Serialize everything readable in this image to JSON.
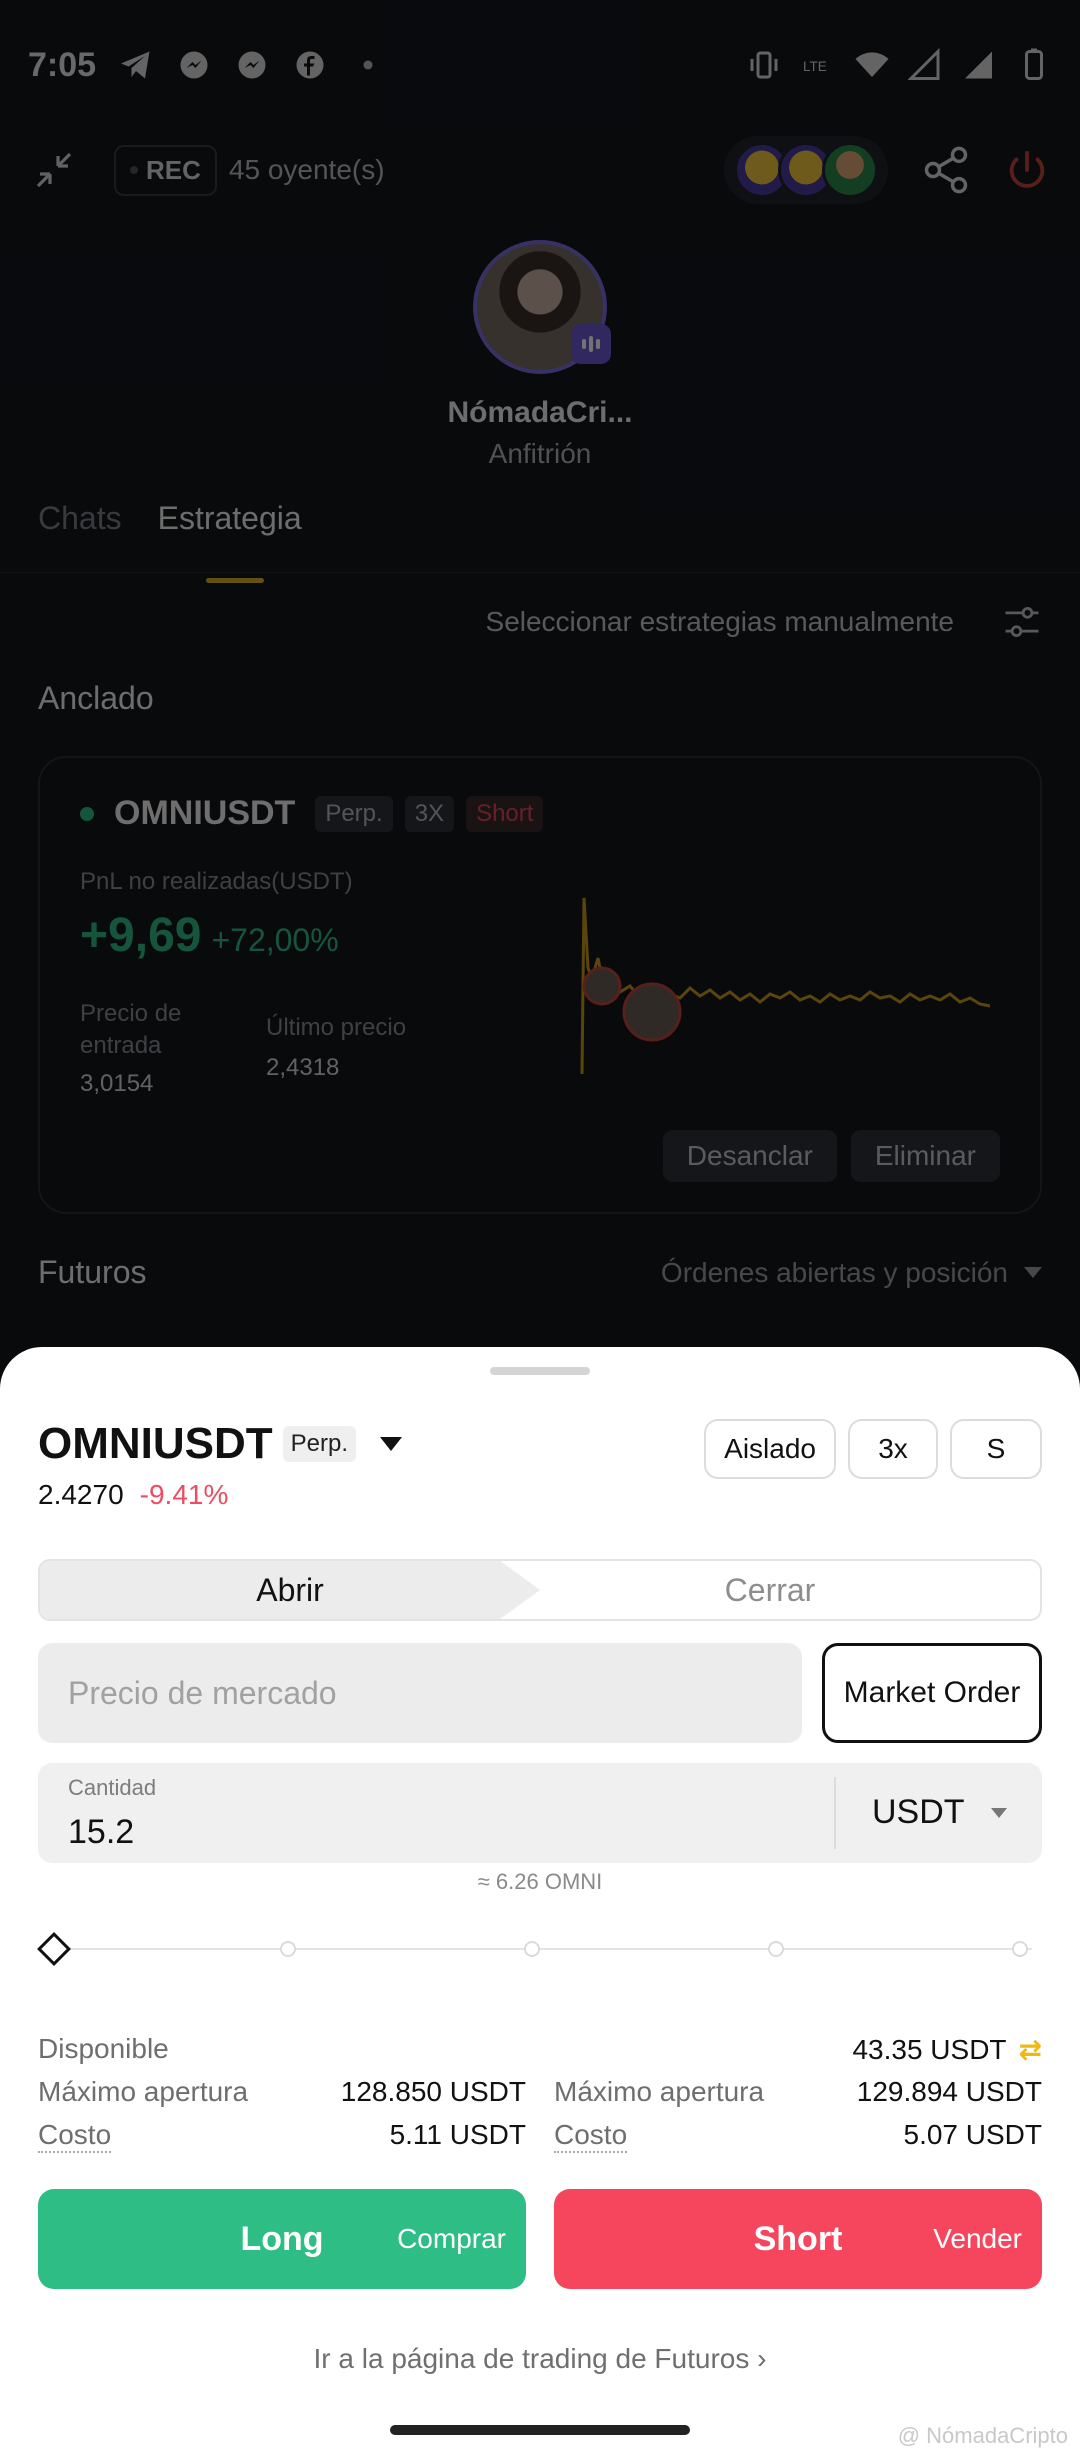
{
  "status": {
    "time": "7:05",
    "left_icons": [
      "telegram-icon",
      "messenger-icon",
      "messenger-icon",
      "facebook-icon",
      "dot-icon"
    ],
    "right_icons": [
      "vibrate-icon",
      "lte-icon",
      "wifi-icon",
      "signal-icon",
      "signal-icon",
      "battery-icon"
    ]
  },
  "topbar": {
    "rec_label": "REC",
    "listeners": "45 oyente(s)"
  },
  "host": {
    "name": "NómadaCri...",
    "role": "Anfitrión"
  },
  "tabs": [
    {
      "label": "Chats",
      "active": false
    },
    {
      "label": "Estrategia",
      "active": true
    }
  ],
  "strategy": {
    "manual_label": "Seleccionar estrategias manualmente",
    "pinned_title": "Anclado",
    "futures_title": "Futuros",
    "futures_filter": "Órdenes abiertas y posición"
  },
  "pinned": {
    "symbol": "OMNIUSDT",
    "tags": [
      "Perp.",
      "3X",
      "Short"
    ],
    "pnl_label": "PnL no realizadas(USDT)",
    "pnl_value": "+9,69",
    "pnl_pct": "+72,00%",
    "entry_label": "Precio de entrada",
    "entry_value": "3,0154",
    "last_label": "Último precio",
    "last_value": "2,4318",
    "unpin_label": "Desanclar",
    "delete_label": "Eliminar",
    "line_color": "#c99a1c"
  },
  "sheet": {
    "symbol": "OMNIUSDT",
    "tag": "Perp.",
    "price": "2.4270",
    "change": "-9.41%",
    "margin_mode": "Aislado",
    "leverage": "3x",
    "side": "S",
    "open_label": "Abrir",
    "close_label": "Cerrar",
    "price_placeholder": "Precio de mercado",
    "order_type": "Market Order",
    "qty_label": "Cantidad",
    "qty_value": "15.2",
    "qty_unit": "USDT",
    "approx": "≈ 6.26 OMNI",
    "slider_value": 0,
    "available_label": "Disponible",
    "available_value": "43.35 USDT",
    "long_max_label": "Máximo apertura",
    "long_max_value": "128.850 USDT",
    "long_cost_label": "Costo",
    "long_cost_value": "5.11 USDT",
    "short_max_label": "Máximo apertura",
    "short_max_value": "129.894 USDT",
    "short_cost_label": "Costo",
    "short_cost_value": "5.07 USDT",
    "long_label": "Long",
    "long_sub": "Comprar",
    "short_label": "Short",
    "short_sub": "Vender",
    "goto_label": "Ir a la página de trading de Futuros",
    "watermark": "@ NómadaCripto"
  },
  "colors": {
    "green": "#2ebd85",
    "red": "#f6465d",
    "accent": "#e0b12a"
  }
}
